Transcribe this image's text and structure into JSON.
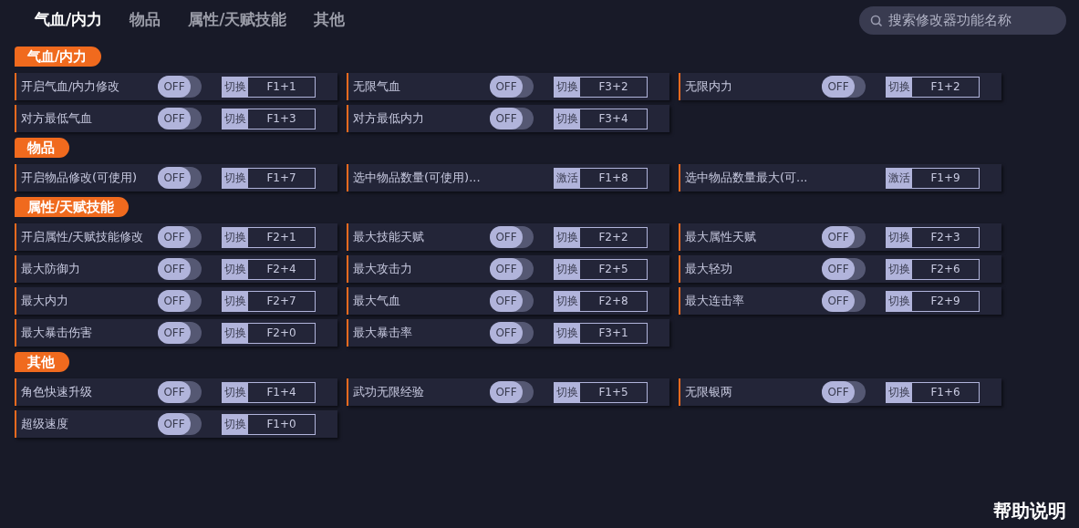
{
  "tabs": [
    {
      "label": "气血/内力",
      "selected": true
    },
    {
      "label": "物品",
      "selected": false
    },
    {
      "label": "属性/天赋技能",
      "selected": false
    },
    {
      "label": "其他",
      "selected": false
    }
  ],
  "search": {
    "placeholder": "搜索修改器功能名称"
  },
  "sections": [
    {
      "title": "气血/内力",
      "items": [
        {
          "label": "开启气血/内力修改",
          "kind": "toggle",
          "on": false,
          "state_label": "OFF",
          "action": "切换",
          "hotkey": "F1+1"
        },
        {
          "label": "无限气血",
          "kind": "toggle",
          "on": false,
          "state_label": "OFF",
          "action": "切换",
          "hotkey": "F3+2"
        },
        {
          "label": "无限内力",
          "kind": "toggle",
          "on": false,
          "state_label": "OFF",
          "action": "切换",
          "hotkey": "F1+2"
        },
        {
          "label": "对方最低气血",
          "kind": "toggle",
          "on": false,
          "state_label": "OFF",
          "action": "切换",
          "hotkey": "F1+3"
        },
        {
          "label": "对方最低内力",
          "kind": "toggle",
          "on": false,
          "state_label": "OFF",
          "action": "切换",
          "hotkey": "F3+4"
        }
      ]
    },
    {
      "title": "物品",
      "items": [
        {
          "label": "开启物品修改(可使用)",
          "kind": "toggle",
          "on": false,
          "state_label": "OFF",
          "action": "切换",
          "hotkey": "F1+7"
        },
        {
          "label": "选中物品数量(可使用)...",
          "kind": "button",
          "action": "激活",
          "hotkey": "F1+8"
        },
        {
          "label": "选中物品数量最大(可...",
          "kind": "button",
          "action": "激活",
          "hotkey": "F1+9"
        }
      ]
    },
    {
      "title": "属性/天赋技能",
      "items": [
        {
          "label": "开启属性/天赋技能修改",
          "kind": "toggle",
          "on": false,
          "state_label": "OFF",
          "action": "切换",
          "hotkey": "F2+1"
        },
        {
          "label": "最大技能天赋",
          "kind": "toggle",
          "on": false,
          "state_label": "OFF",
          "action": "切换",
          "hotkey": "F2+2"
        },
        {
          "label": "最大属性天赋",
          "kind": "toggle",
          "on": false,
          "state_label": "OFF",
          "action": "切换",
          "hotkey": "F2+3"
        },
        {
          "label": "最大防御力",
          "kind": "toggle",
          "on": false,
          "state_label": "OFF",
          "action": "切换",
          "hotkey": "F2+4"
        },
        {
          "label": "最大攻击力",
          "kind": "toggle",
          "on": false,
          "state_label": "OFF",
          "action": "切换",
          "hotkey": "F2+5"
        },
        {
          "label": "最大轻功",
          "kind": "toggle",
          "on": false,
          "state_label": "OFF",
          "action": "切换",
          "hotkey": "F2+6"
        },
        {
          "label": "最大内力",
          "kind": "toggle",
          "on": false,
          "state_label": "OFF",
          "action": "切换",
          "hotkey": "F2+7"
        },
        {
          "label": "最大气血",
          "kind": "toggle",
          "on": false,
          "state_label": "OFF",
          "action": "切换",
          "hotkey": "F2+8"
        },
        {
          "label": "最大连击率",
          "kind": "toggle",
          "on": false,
          "state_label": "OFF",
          "action": "切换",
          "hotkey": "F2+9"
        },
        {
          "label": "最大暴击伤害",
          "kind": "toggle",
          "on": false,
          "state_label": "OFF",
          "action": "切换",
          "hotkey": "F2+0"
        },
        {
          "label": "最大暴击率",
          "kind": "toggle",
          "on": false,
          "state_label": "OFF",
          "action": "切换",
          "hotkey": "F3+1"
        }
      ]
    },
    {
      "title": "其他",
      "items": [
        {
          "label": "角色快速升级",
          "kind": "toggle",
          "on": false,
          "state_label": "OFF",
          "action": "切换",
          "hotkey": "F1+4"
        },
        {
          "label": "武功无限经验",
          "kind": "toggle",
          "on": false,
          "state_label": "OFF",
          "action": "切换",
          "hotkey": "F1+5"
        },
        {
          "label": "无限银两",
          "kind": "toggle",
          "on": false,
          "state_label": "OFF",
          "action": "切换",
          "hotkey": "F1+6"
        },
        {
          "label": "超级速度",
          "kind": "toggle",
          "on": false,
          "state_label": "OFF",
          "action": "切换",
          "hotkey": "F1+0"
        }
      ]
    }
  ],
  "help": "帮助说明"
}
